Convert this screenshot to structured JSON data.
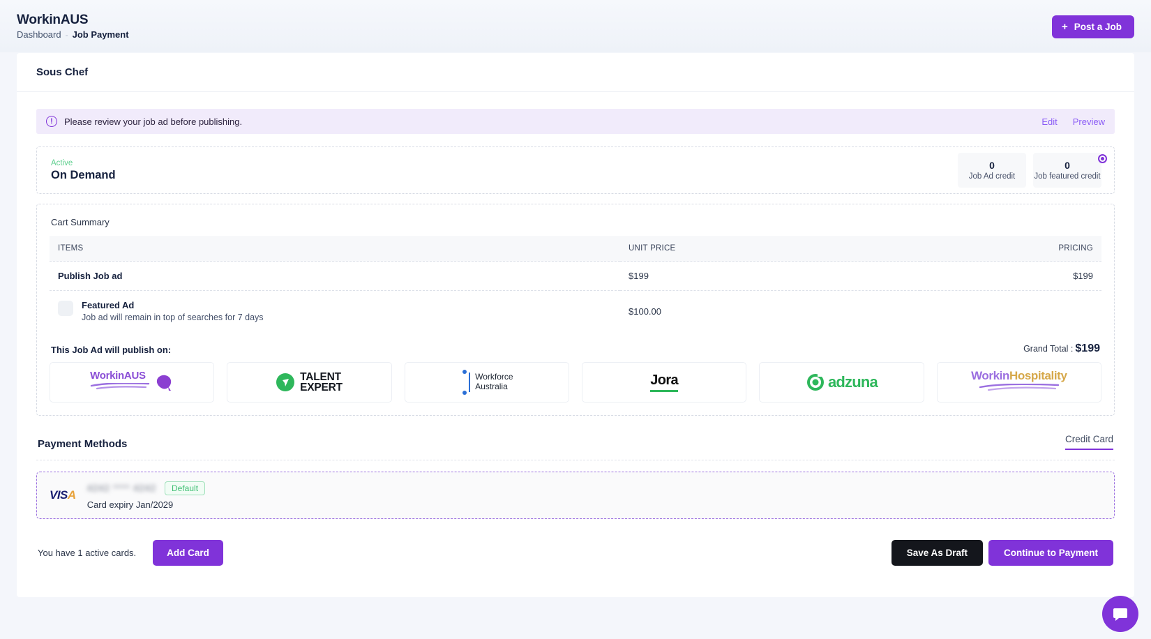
{
  "topbar": {
    "brand": "WorkinAUS",
    "breadcrumb_home": "Dashboard",
    "breadcrumb_sep": "-",
    "breadcrumb_current": "Job Payment",
    "post_job_plus": "+",
    "post_job_label": "Post a Job"
  },
  "page": {
    "job_title": "Sous Chef"
  },
  "alert": {
    "icon": "!",
    "message": "Please review your job ad before publishing.",
    "edit_label": "Edit",
    "preview_label": "Preview"
  },
  "plan": {
    "status": "Active",
    "name": "On Demand",
    "credits": [
      {
        "value": "0",
        "label": "Job Ad credit"
      },
      {
        "value": "0",
        "label": "Job featured credit"
      }
    ]
  },
  "cart": {
    "title": "Cart Summary",
    "columns": [
      "ITEMS",
      "UNIT PRICE",
      "PRICING"
    ],
    "rows": [
      {
        "item": "Publish Job ad",
        "description": "",
        "unit_price": "$199",
        "pricing": "$199",
        "has_checkbox": false
      },
      {
        "item": "Featured Ad",
        "description": "Job ad will remain in top of searches for 7 days",
        "unit_price": "$100.00",
        "pricing": "",
        "has_checkbox": true
      }
    ]
  },
  "publish": {
    "label": "This Job Ad will publish on:",
    "grand_total_label": "Grand Total :",
    "grand_total_value": "$199",
    "partners": [
      {
        "name": "WorkinAUS",
        "part1": "Workin",
        "part2": "AUS"
      },
      {
        "name": "TALENT EXPERT",
        "line1": "TALENT",
        "line2": "EXPERT"
      },
      {
        "name": "Workforce Australia",
        "line1": "Workforce",
        "line2": "Australia"
      },
      {
        "name": "Jora",
        "line1": "Jora"
      },
      {
        "name": "adzuna",
        "line1": "adzuna"
      },
      {
        "name": "WorkinHospitality",
        "part1": "Workin",
        "part2": "Hospitality"
      }
    ]
  },
  "payment": {
    "title": "Payment Methods",
    "tab_label": "Credit Card",
    "card": {
      "brand": "VISA",
      "number": "4242 **** 4242",
      "badge": "Default",
      "expiry": "Card expiry Jan/2029"
    }
  },
  "footer": {
    "active_cards_text": "You have 1 active cards.",
    "add_card_label": "Add Card",
    "save_draft_label": "Save As Draft",
    "continue_label": "Continue to Payment"
  },
  "colors": {
    "accent": "#8033d9",
    "alert_bg": "#f1ebfb",
    "success": "#3fbf73",
    "dark_button": "#14161c"
  }
}
